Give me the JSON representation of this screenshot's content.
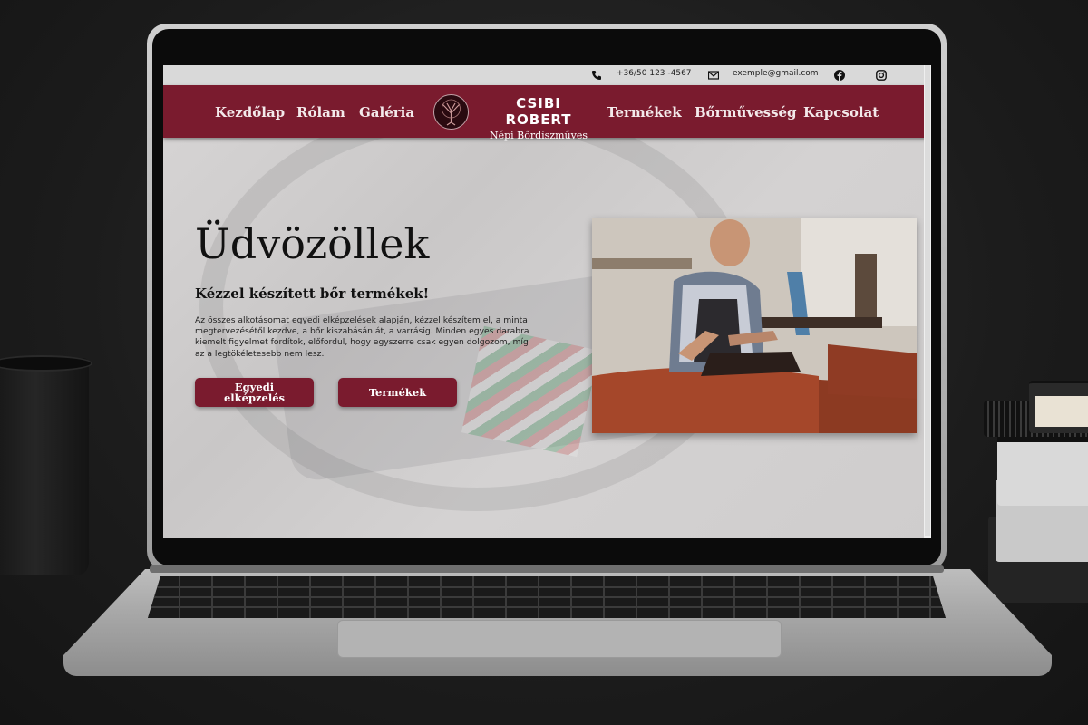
{
  "topbar": {
    "phone": "+36/50 123 -4567",
    "email": "exemple@gmail.com",
    "phone_icon": "phone-icon",
    "email_icon": "envelope-icon",
    "facebook_icon": "facebook-icon",
    "instagram_icon": "instagram-icon"
  },
  "nav": {
    "items": [
      "Kezdőlap",
      "Rólam",
      "Galéria",
      "Termékek",
      "Bőrművesség",
      "Kapcsolat"
    ],
    "brand_name": "CSIBI ROBERT",
    "brand_sub": "Népi Bőrdíszműves"
  },
  "hero": {
    "title": "Üdvözöllek",
    "subtitle": "Kézzel készített bőr termékek!",
    "description": "Az összes alkotásomat egyedi elképzelések alapján, kézzel készítem el, a minta megtervezésétől kezdve, a bőr kiszabásán át, a varrásig. Minden egyes darabra kiemelt figyelmet fordítok, előfordul, hogy egyszerre csak egyen dolgozom, míg az a legtökéletesebb nem lesz.",
    "buttons": [
      "Egyedi elképzelés",
      "Termékek"
    ]
  },
  "colors": {
    "brand": "#7a1b2e",
    "nav_text": "#f3e9ea"
  }
}
